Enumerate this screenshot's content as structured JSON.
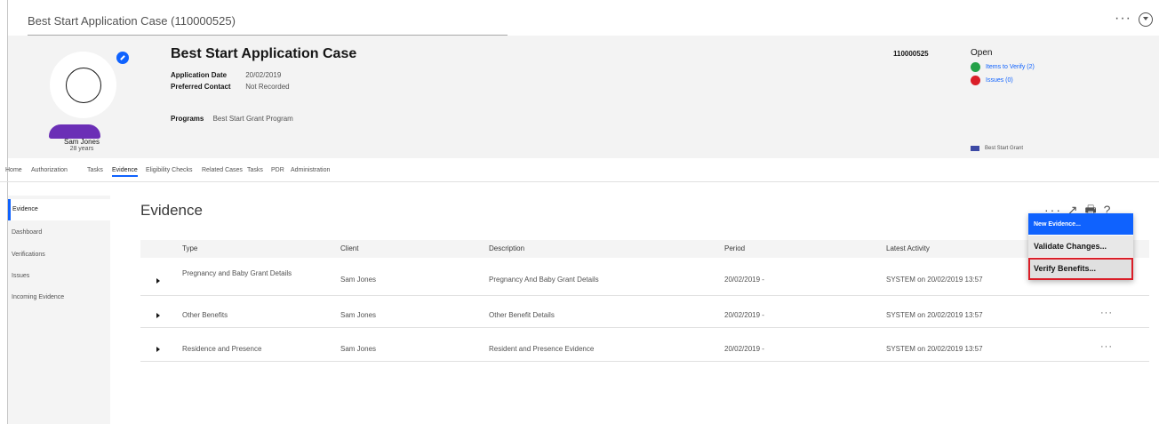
{
  "title_bar": {
    "case_title": "Best Start Application Case (110000525)",
    "more_label": "···"
  },
  "header": {
    "person_name": "Sam Jones",
    "person_age": "28 years",
    "case_heading": "Best Start Application Case",
    "application_date_label": "Application Date",
    "application_date_value": "20/02/2019",
    "preferred_contact_label": "Preferred Contact",
    "preferred_contact_value": "Not Recorded",
    "programs_label": "Programs",
    "programs_value": "Best Start Grant Program",
    "case_reference": "110000525",
    "status": "Open",
    "items_to_verify": "Items to Verify (2)",
    "issues": "Issues (0)",
    "program_badge": "Best Start Grant"
  },
  "tabs": [
    {
      "label": "Home"
    },
    {
      "label": "Authorization"
    },
    {
      "label": "Tasks"
    },
    {
      "label": "Evidence"
    },
    {
      "label": "Eligibility Checks"
    },
    {
      "label": "Related Cases"
    },
    {
      "label": "Tasks"
    },
    {
      "label": "PDR"
    },
    {
      "label": "Administration"
    }
  ],
  "side_nav": [
    {
      "label": "Evidence"
    },
    {
      "label": "Dashboard"
    },
    {
      "label": "Verifications"
    },
    {
      "label": "Issues"
    },
    {
      "label": "Incoming Evidence"
    }
  ],
  "main": {
    "title": "Evidence",
    "actions": "··· ↗ 🖶 ?"
  },
  "table": {
    "headers": [
      "Type",
      "Client",
      "Description",
      "Period",
      "Latest Activity"
    ],
    "rows": [
      {
        "type": "Pregnancy and Baby Grant Details",
        "client": "Sam Jones",
        "description": "Pregnancy And Baby Grant Details",
        "period": "20/02/2019 -",
        "activity": "SYSTEM on 20/02/2019 13:57"
      },
      {
        "type": "Other Benefits",
        "client": "Sam Jones",
        "description": "Other Benefit Details",
        "period": "20/02/2019 -",
        "activity": "SYSTEM on 20/02/2019 13:57"
      },
      {
        "type": "Residence and Presence",
        "client": "Sam Jones",
        "description": "Resident and Presence Evidence",
        "period": "20/02/2019 -",
        "activity": "SYSTEM on 20/02/2019 13:57"
      }
    ],
    "row_more": "···"
  },
  "menu": {
    "items": [
      "New Evidence...",
      "Validate Changes...",
      "Verify Benefits..."
    ]
  },
  "colors": {
    "accent": "#0f62fe",
    "avatar": "#6b2fb6",
    "highlight": "#da1e28"
  }
}
